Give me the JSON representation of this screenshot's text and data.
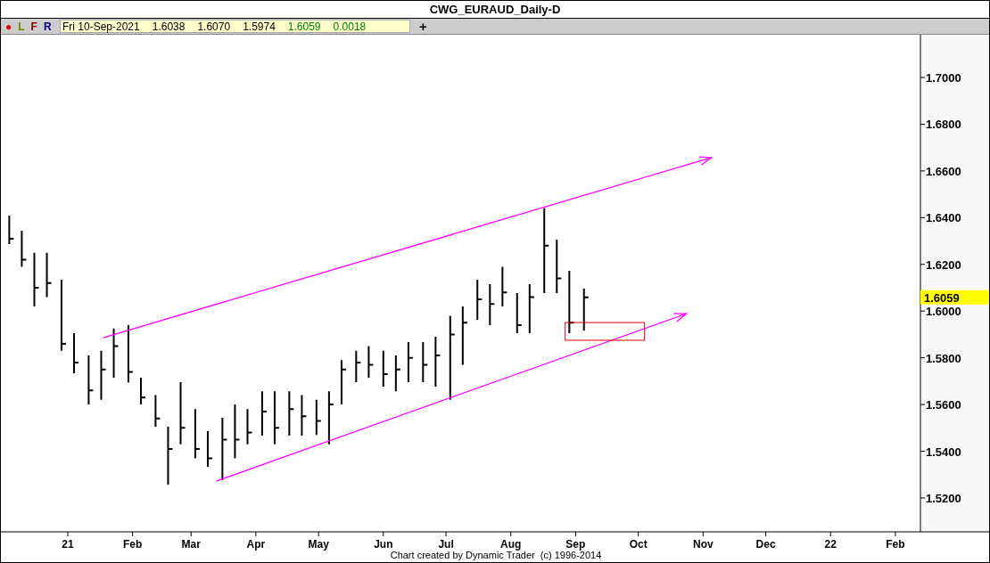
{
  "window": {
    "title": "CWG_EURAUD_Daily-D"
  },
  "toolbar": {
    "buttons": [
      {
        "label": "●",
        "color": "#e00000"
      },
      {
        "label": "L",
        "color": "#808000"
      },
      {
        "label": "F",
        "color": "#800000"
      },
      {
        "label": "R",
        "color": "#000080"
      }
    ],
    "info": [
      {
        "text": "Fri 10-Sep-2021",
        "color": "#000000"
      },
      {
        "text": "1.6038",
        "color": "#000000"
      },
      {
        "text": "1.6070",
        "color": "#000000"
      },
      {
        "text": "1.5974",
        "color": "#000000"
      },
      {
        "text": "1.6059",
        "color": "#008000"
      },
      {
        "text": "0.0018",
        "color": "#008000"
      }
    ],
    "add_button": "+"
  },
  "chart": {
    "price_axis": [
      "1.7000",
      "1.6800",
      "1.6600",
      "1.6400",
      "1.6200",
      "1.6000",
      "1.5800",
      "1.5600",
      "1.5400",
      "1.5200"
    ],
    "current_price": "1.6059",
    "date_axis": [
      "21",
      "Feb",
      "Mar",
      "Apr",
      "May",
      "Jun",
      "Jul",
      "Aug",
      "Sep",
      "Oct",
      "Nov",
      "Dec",
      "22",
      "Feb"
    ],
    "footer": "Chart created by Dynamic Trader  (c) 1996-2014"
  }
}
